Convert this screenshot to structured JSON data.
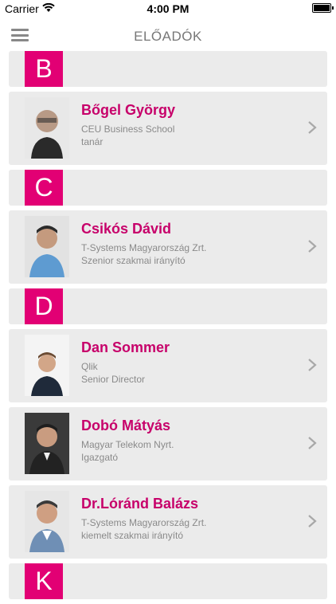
{
  "status": {
    "carrier": "Carrier",
    "time": "4:00 PM"
  },
  "nav": {
    "title": "ELŐADÓK",
    "menu_icon": "hamburger-menu-icon"
  },
  "colors": {
    "accent": "#e20074",
    "name": "#c7006a"
  },
  "sections": [
    {
      "letter": "B",
      "people": [
        {
          "name": "Bőgel György",
          "company": "CEU Business School",
          "role": "tanár"
        }
      ]
    },
    {
      "letter": "C",
      "people": [
        {
          "name": "Csikós Dávid",
          "company": "T-Systems Magyarország Zrt.",
          "role": "Szenior szakmai irányító"
        }
      ]
    },
    {
      "letter": "D",
      "people": [
        {
          "name": "Dan Sommer",
          "company": "Qlik",
          "role": "Senior Director"
        },
        {
          "name": "Dobó Mátyás",
          "company": "Magyar Telekom Nyrt.",
          "role": "Igazgató"
        },
        {
          "name": "Dr.Lóránd Balázs",
          "company": "T-Systems Magyarország Zrt.",
          "role": "kiemelt szakmai irányító"
        }
      ]
    },
    {
      "letter": "K",
      "people": []
    }
  ]
}
